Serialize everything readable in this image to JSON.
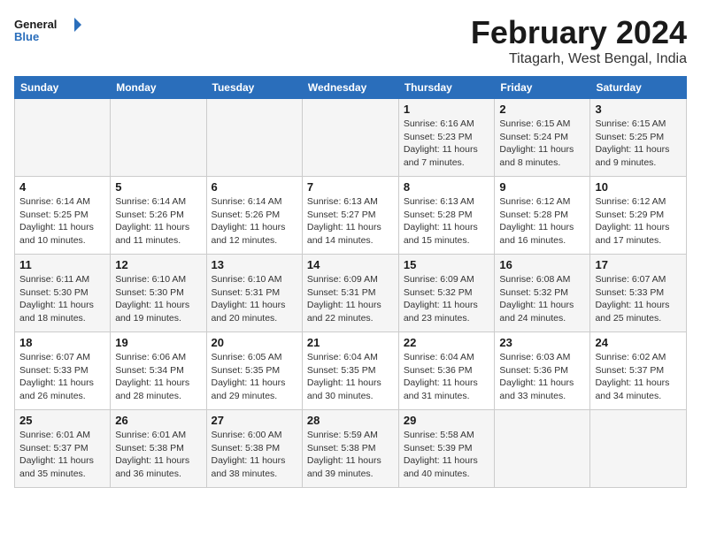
{
  "logo": {
    "line1": "General",
    "line2": "Blue"
  },
  "title": "February 2024",
  "subtitle": "Titagarh, West Bengal, India",
  "days_of_week": [
    "Sunday",
    "Monday",
    "Tuesday",
    "Wednesday",
    "Thursday",
    "Friday",
    "Saturday"
  ],
  "weeks": [
    [
      {
        "day": "",
        "info": ""
      },
      {
        "day": "",
        "info": ""
      },
      {
        "day": "",
        "info": ""
      },
      {
        "day": "",
        "info": ""
      },
      {
        "day": "1",
        "info": "Sunrise: 6:16 AM\nSunset: 5:23 PM\nDaylight: 11 hours and 7 minutes."
      },
      {
        "day": "2",
        "info": "Sunrise: 6:15 AM\nSunset: 5:24 PM\nDaylight: 11 hours and 8 minutes."
      },
      {
        "day": "3",
        "info": "Sunrise: 6:15 AM\nSunset: 5:25 PM\nDaylight: 11 hours and 9 minutes."
      }
    ],
    [
      {
        "day": "4",
        "info": "Sunrise: 6:14 AM\nSunset: 5:25 PM\nDaylight: 11 hours and 10 minutes."
      },
      {
        "day": "5",
        "info": "Sunrise: 6:14 AM\nSunset: 5:26 PM\nDaylight: 11 hours and 11 minutes."
      },
      {
        "day": "6",
        "info": "Sunrise: 6:14 AM\nSunset: 5:26 PM\nDaylight: 11 hours and 12 minutes."
      },
      {
        "day": "7",
        "info": "Sunrise: 6:13 AM\nSunset: 5:27 PM\nDaylight: 11 hours and 14 minutes."
      },
      {
        "day": "8",
        "info": "Sunrise: 6:13 AM\nSunset: 5:28 PM\nDaylight: 11 hours and 15 minutes."
      },
      {
        "day": "9",
        "info": "Sunrise: 6:12 AM\nSunset: 5:28 PM\nDaylight: 11 hours and 16 minutes."
      },
      {
        "day": "10",
        "info": "Sunrise: 6:12 AM\nSunset: 5:29 PM\nDaylight: 11 hours and 17 minutes."
      }
    ],
    [
      {
        "day": "11",
        "info": "Sunrise: 6:11 AM\nSunset: 5:30 PM\nDaylight: 11 hours and 18 minutes."
      },
      {
        "day": "12",
        "info": "Sunrise: 6:10 AM\nSunset: 5:30 PM\nDaylight: 11 hours and 19 minutes."
      },
      {
        "day": "13",
        "info": "Sunrise: 6:10 AM\nSunset: 5:31 PM\nDaylight: 11 hours and 20 minutes."
      },
      {
        "day": "14",
        "info": "Sunrise: 6:09 AM\nSunset: 5:31 PM\nDaylight: 11 hours and 22 minutes."
      },
      {
        "day": "15",
        "info": "Sunrise: 6:09 AM\nSunset: 5:32 PM\nDaylight: 11 hours and 23 minutes."
      },
      {
        "day": "16",
        "info": "Sunrise: 6:08 AM\nSunset: 5:32 PM\nDaylight: 11 hours and 24 minutes."
      },
      {
        "day": "17",
        "info": "Sunrise: 6:07 AM\nSunset: 5:33 PM\nDaylight: 11 hours and 25 minutes."
      }
    ],
    [
      {
        "day": "18",
        "info": "Sunrise: 6:07 AM\nSunset: 5:33 PM\nDaylight: 11 hours and 26 minutes."
      },
      {
        "day": "19",
        "info": "Sunrise: 6:06 AM\nSunset: 5:34 PM\nDaylight: 11 hours and 28 minutes."
      },
      {
        "day": "20",
        "info": "Sunrise: 6:05 AM\nSunset: 5:35 PM\nDaylight: 11 hours and 29 minutes."
      },
      {
        "day": "21",
        "info": "Sunrise: 6:04 AM\nSunset: 5:35 PM\nDaylight: 11 hours and 30 minutes."
      },
      {
        "day": "22",
        "info": "Sunrise: 6:04 AM\nSunset: 5:36 PM\nDaylight: 11 hours and 31 minutes."
      },
      {
        "day": "23",
        "info": "Sunrise: 6:03 AM\nSunset: 5:36 PM\nDaylight: 11 hours and 33 minutes."
      },
      {
        "day": "24",
        "info": "Sunrise: 6:02 AM\nSunset: 5:37 PM\nDaylight: 11 hours and 34 minutes."
      }
    ],
    [
      {
        "day": "25",
        "info": "Sunrise: 6:01 AM\nSunset: 5:37 PM\nDaylight: 11 hours and 35 minutes."
      },
      {
        "day": "26",
        "info": "Sunrise: 6:01 AM\nSunset: 5:38 PM\nDaylight: 11 hours and 36 minutes."
      },
      {
        "day": "27",
        "info": "Sunrise: 6:00 AM\nSunset: 5:38 PM\nDaylight: 11 hours and 38 minutes."
      },
      {
        "day": "28",
        "info": "Sunrise: 5:59 AM\nSunset: 5:38 PM\nDaylight: 11 hours and 39 minutes."
      },
      {
        "day": "29",
        "info": "Sunrise: 5:58 AM\nSunset: 5:39 PM\nDaylight: 11 hours and 40 minutes."
      },
      {
        "day": "",
        "info": ""
      },
      {
        "day": "",
        "info": ""
      }
    ]
  ]
}
